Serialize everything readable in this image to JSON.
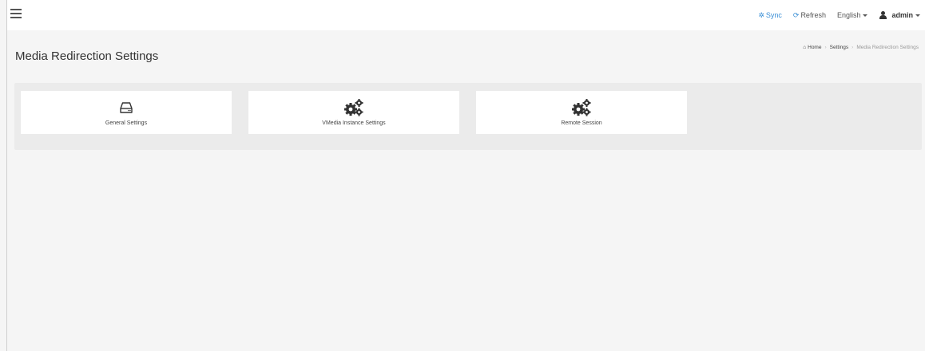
{
  "header": {
    "sync_label": "Sync",
    "refresh_label": "Refresh",
    "language": "English",
    "user": "admin"
  },
  "page": {
    "title": "Media Redirection Settings"
  },
  "breadcrumb": {
    "home": "Home",
    "settings": "Settings",
    "current": "Media Redirection Settings"
  },
  "tiles": [
    {
      "label": "General Settings",
      "icon": "hard-drive-icon"
    },
    {
      "label": "VMedia Instance Settings",
      "icon": "gears-icon"
    },
    {
      "label": "Remote Session",
      "icon": "gears-icon"
    }
  ],
  "colors": {
    "accent": "#3b8fd6",
    "background": "#f5f5f5",
    "panel": "#ebebeb"
  }
}
